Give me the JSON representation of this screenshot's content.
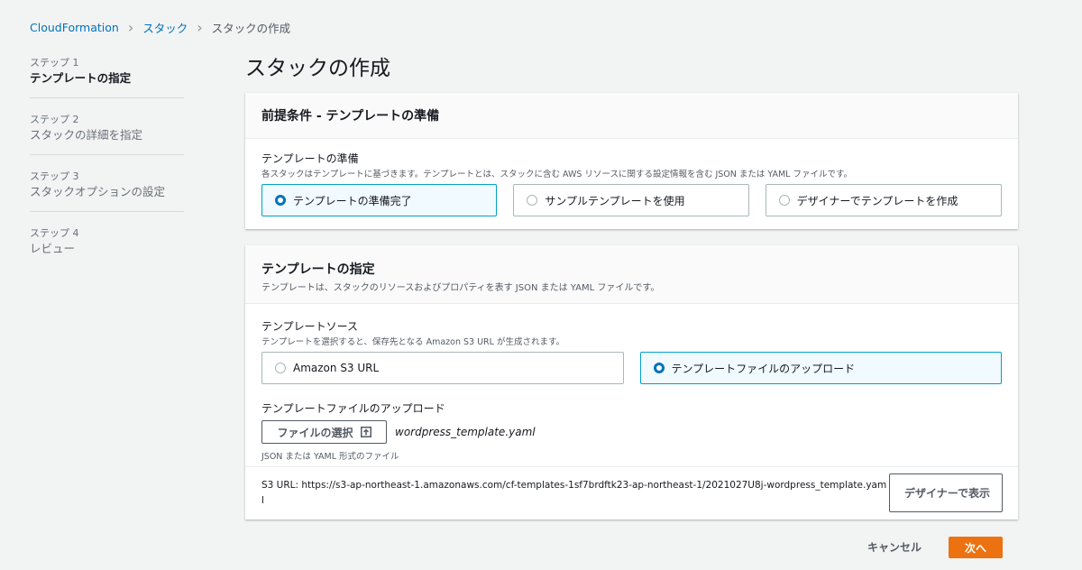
{
  "breadcrumb": {
    "items": [
      {
        "label": "CloudFormation"
      },
      {
        "label": "スタック"
      },
      {
        "label": "スタックの作成"
      }
    ]
  },
  "steps": [
    {
      "number": "ステップ 1",
      "title": "テンプレートの指定",
      "active": true
    },
    {
      "number": "ステップ 2",
      "title": "スタックの詳細を指定",
      "active": false
    },
    {
      "number": "ステップ 3",
      "title": "スタックオプションの設定",
      "active": false
    },
    {
      "number": "ステップ 4",
      "title": "レビュー",
      "active": false
    }
  ],
  "page": {
    "title": "スタックの作成"
  },
  "prereq": {
    "title": "前提条件 - テンプレートの準備",
    "field_label": "テンプレートの準備",
    "field_desc": "各スタックはテンプレートに基づきます。テンプレートとは、スタックに含む AWS リソースに関する設定情報を含む JSON または YAML ファイルです。",
    "options": [
      {
        "label": "テンプレートの準備完了",
        "selected": true
      },
      {
        "label": "サンプルテンプレートを使用",
        "selected": false
      },
      {
        "label": "デザイナーでテンプレートを作成",
        "selected": false
      }
    ]
  },
  "template": {
    "title": "テンプレートの指定",
    "desc": "テンプレートは、スタックのリソースおよびプロパティを表す JSON または YAML ファイルです。",
    "source_label": "テンプレートソース",
    "source_desc": "テンプレートを選択すると、保存先となる Amazon S3 URL が生成されます。",
    "options": [
      {
        "label": "Amazon S3 URL",
        "selected": false
      },
      {
        "label": "テンプレートファイルのアップロード",
        "selected": true
      }
    ],
    "upload_label": "テンプレートファイルのアップロード",
    "choose_file_label": "ファイルの選択",
    "file_name": "wordpress_template.yaml",
    "file_hint": "JSON または YAML 形式のファイル",
    "s3_url_label": "S3 URL:",
    "s3_url_value": "https://s3-ap-northeast-1.amazonaws.com/cf-templates-1sf7brdftk23-ap-northeast-1/2021027U8j-wordpress_template.yaml",
    "designer_button": "デザイナーで表示"
  },
  "footer": {
    "cancel": "キャンセル",
    "next": "次へ"
  },
  "colors": {
    "link": "#0073bb",
    "primary": "#ec7211",
    "selected_border": "#00a1c9",
    "selected_bg": "#f1faff"
  }
}
